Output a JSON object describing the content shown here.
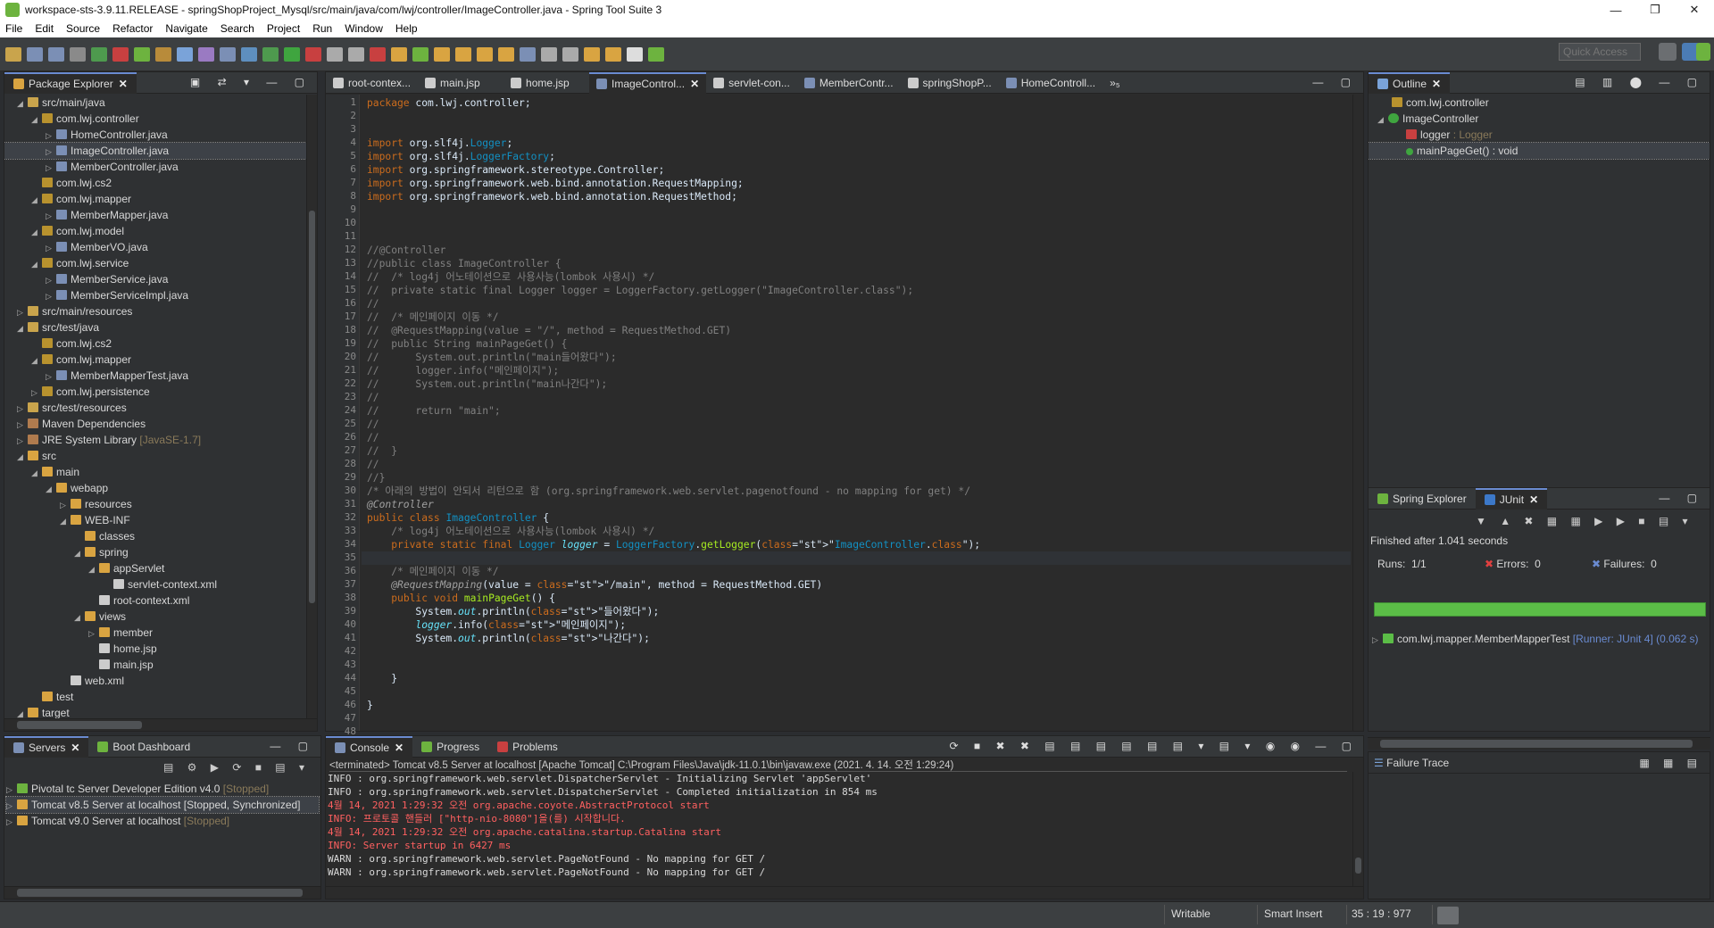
{
  "window": {
    "title": "workspace-sts-3.9.11.RELEASE - springShopProject_Mysql/src/main/java/com/lwj/controller/ImageController.java - Spring Tool Suite 3",
    "minimize": "—",
    "maximize": "❐",
    "close": "✕"
  },
  "menu": [
    "File",
    "Edit",
    "Source",
    "Refactor",
    "Navigate",
    "Search",
    "Project",
    "Run",
    "Window",
    "Help"
  ],
  "quick_access": {
    "placeholder": "Quick Access"
  },
  "package_explorer": {
    "tab": "Package Explorer",
    "items": [
      {
        "label": "src/main/java",
        "extra": ""
      },
      {
        "label": "com.lwj.controller",
        "extra": ""
      },
      {
        "label": "HomeController.java",
        "extra": ""
      },
      {
        "label": "ImageController.java",
        "extra": ""
      },
      {
        "label": "MemberController.java",
        "extra": ""
      },
      {
        "label": "com.lwj.cs2",
        "extra": ""
      },
      {
        "label": "com.lwj.mapper",
        "extra": ""
      },
      {
        "label": "MemberMapper.java",
        "extra": ""
      },
      {
        "label": "com.lwj.model",
        "extra": ""
      },
      {
        "label": "MemberVO.java",
        "extra": ""
      },
      {
        "label": "com.lwj.service",
        "extra": ""
      },
      {
        "label": "MemberService.java",
        "extra": ""
      },
      {
        "label": "MemberServiceImpl.java",
        "extra": ""
      },
      {
        "label": "src/main/resources",
        "extra": ""
      },
      {
        "label": "src/test/java",
        "extra": ""
      },
      {
        "label": "com.lwj.cs2",
        "extra": ""
      },
      {
        "label": "com.lwj.mapper",
        "extra": ""
      },
      {
        "label": "MemberMapperTest.java",
        "extra": ""
      },
      {
        "label": "com.lwj.persistence",
        "extra": ""
      },
      {
        "label": "src/test/resources",
        "extra": ""
      },
      {
        "label": "Maven Dependencies",
        "extra": ""
      },
      {
        "label": "JRE System Library",
        "extra": "[JavaSE-1.7]"
      },
      {
        "label": "src",
        "extra": ""
      },
      {
        "label": "main",
        "extra": ""
      },
      {
        "label": "webapp",
        "extra": ""
      },
      {
        "label": "resources",
        "extra": ""
      },
      {
        "label": "WEB-INF",
        "extra": ""
      },
      {
        "label": "classes",
        "extra": ""
      },
      {
        "label": "spring",
        "extra": ""
      },
      {
        "label": "appServlet",
        "extra": ""
      },
      {
        "label": "servlet-context.xml",
        "extra": ""
      },
      {
        "label": "root-context.xml",
        "extra": ""
      },
      {
        "label": "views",
        "extra": ""
      },
      {
        "label": "member",
        "extra": ""
      },
      {
        "label": "home.jsp",
        "extra": ""
      },
      {
        "label": "main.jsp",
        "extra": ""
      },
      {
        "label": "web.xml",
        "extra": ""
      },
      {
        "label": "test",
        "extra": ""
      },
      {
        "label": "target",
        "extra": ""
      }
    ]
  },
  "editor_tabs": [
    "root-contex...",
    "main.jsp",
    "home.jsp",
    "ImageControl...",
    "servlet-con...",
    "MemberContr...",
    "springShopP...",
    "HomeControll...",
    "»₅"
  ],
  "code_lines": [
    "package com.lwj.controller;",
    "",
    "",
    "import org.slf4j.Logger;",
    "import org.slf4j.LoggerFactory;",
    "import org.springframework.stereotype.Controller;",
    "import org.springframework.web.bind.annotation.RequestMapping;",
    "import org.springframework.web.bind.annotation.RequestMethod;",
    "",
    "",
    "",
    "//@Controller",
    "//public class ImageController {",
    "//  /* log4j 어노테이션으로 사용사능(lombok 사용시) */",
    "//  private static final Logger logger = LoggerFactory.getLogger(\"ImageController.class\");",
    "//",
    "//  /* 메인페이지 이동 */",
    "//  @RequestMapping(value = \"/\", method = RequestMethod.GET)",
    "//  public String mainPageGet() {",
    "//      System.out.println(\"main들어왔다\");",
    "//      logger.info(\"메인페이지\");",
    "//      System.out.println(\"main나간다\");",
    "//",
    "//      return \"main\";",
    "//",
    "//",
    "//  }",
    "//",
    "//}",
    "/* 아래의 방법이 안되서 리턴으로 함 (org.springframework.web.servlet.pagenotfound - no mapping for get) */",
    "@Controller",
    "public class ImageController {",
    "    /* log4j 어노테이션으로 사용사능(lombok 사용시) */",
    "    private static final Logger logger = LoggerFactory.getLogger(\"ImageController.class\");",
    "",
    "    /* 메인페이지 이동 */",
    "    @RequestMapping(value = \"/main\", method = RequestMethod.GET)",
    "    public void mainPageGet() {",
    "        System.out.println(\"들어왔다\");",
    "        logger.info(\"메인페이지\");",
    "        System.out.println(\"나간다\");",
    "",
    "",
    "    }",
    "",
    "}",
    "",
    ""
  ],
  "outline": {
    "tab": "Outline",
    "items": [
      "com.lwj.controller",
      "ImageController",
      "logger",
      "mainPageGet() : void"
    ],
    "logger_type": ": Logger"
  },
  "junit": {
    "tab_spring": "Spring Explorer",
    "tab_junit": "JUnit",
    "finished": "Finished after 1.041 seconds",
    "runs_label": "Runs:",
    "runs": "1/1",
    "errors_label": "Errors:",
    "errors": "0",
    "failures_label": "Failures:",
    "failures": "0",
    "test": "com.lwj.mapper.MemberMapperTest",
    "runner": "[Runner: JUnit 4] (0.062 s)",
    "failure_trace": "Failure Trace",
    "status_color": "#5bbd47"
  },
  "servers": {
    "tab": "Servers",
    "tab2": "Boot Dashboard",
    "items": [
      {
        "name": "Pivotal tc Server Developer Edition v4.0",
        "state": "[Stopped]"
      },
      {
        "name": "Tomcat v8.5 Server at localhost",
        "state": "[Stopped, Synchronized]"
      },
      {
        "name": "Tomcat v9.0 Server at localhost",
        "state": "[Stopped]"
      }
    ]
  },
  "console": {
    "tabs": [
      "Console",
      "Progress",
      "Problems"
    ],
    "header": "<terminated> Tomcat v8.5 Server at localhost [Apache Tomcat] C:\\Program Files\\Java\\jdk-11.0.1\\bin\\javaw.exe (2021. 4. 14. 오전 1:29:24)",
    "lines": [
      {
        "t": "INFO : org.springframework.web.servlet.DispatcherServlet - Initializing Servlet 'appServlet'",
        "c": "w"
      },
      {
        "t": "INFO : org.springframework.web.servlet.DispatcherServlet - Completed initialization in 854 ms",
        "c": "w"
      },
      {
        "t": "4월 14, 2021 1:29:32 오전 org.apache.coyote.AbstractProtocol start",
        "c": "r"
      },
      {
        "t": "INFO: 프로토콜 핸들러 [\"http-nio-8080\"]을(를) 시작합니다.",
        "c": "r"
      },
      {
        "t": "4월 14, 2021 1:29:32 오전 org.apache.catalina.startup.Catalina start",
        "c": "r"
      },
      {
        "t": "INFO: Server startup in 6427 ms",
        "c": "r"
      },
      {
        "t": "WARN : org.springframework.web.servlet.PageNotFound - No mapping for GET /",
        "c": "w"
      },
      {
        "t": "WARN : org.springframework.web.servlet.PageNotFound - No mapping for GET /",
        "c": "w"
      }
    ]
  },
  "status": {
    "writable": "Writable",
    "insert": "Smart Insert",
    "position": "35 : 19 : 977"
  }
}
